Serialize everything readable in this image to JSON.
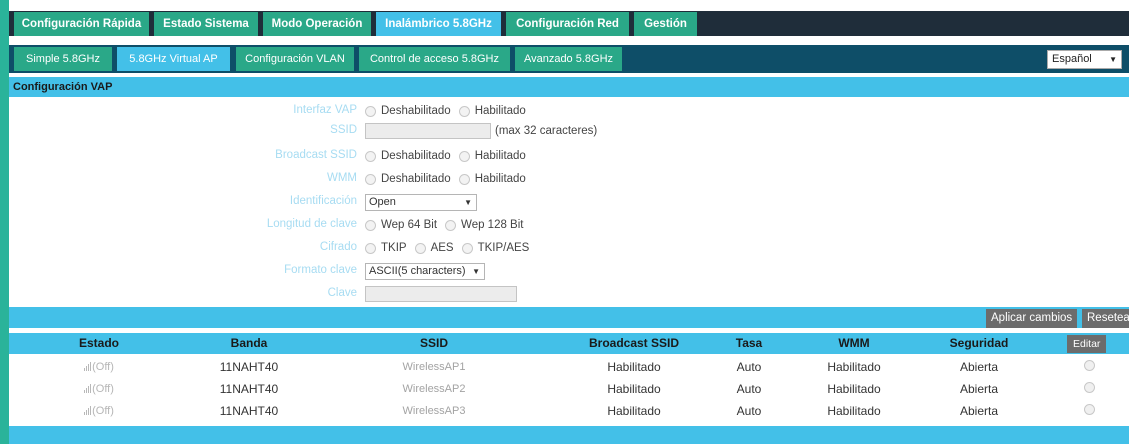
{
  "top_nav": [
    {
      "label": "Configuración Rápida",
      "active": false
    },
    {
      "label": "Estado Sistema",
      "active": false
    },
    {
      "label": "Modo Operación",
      "active": false
    },
    {
      "label": "Inalámbrico 5.8GHz",
      "active": true
    },
    {
      "label": "Configuración Red",
      "active": false
    },
    {
      "label": "Gestión",
      "active": false
    }
  ],
  "sub_nav": [
    {
      "label": "Simple 5.8GHz",
      "active": false
    },
    {
      "label": "5.8GHz Virtual AP",
      "active": true
    },
    {
      "label": "Configuración VLAN",
      "active": false
    },
    {
      "label": "Control de acceso 5.8GHz",
      "active": false
    },
    {
      "label": "Avanzado 5.8GHz",
      "active": false
    }
  ],
  "language": {
    "selected": "Español"
  },
  "section_title": "Configuración VAP",
  "form": {
    "interfaz_vap": {
      "label": "Interfaz VAP",
      "options": [
        "Deshabilitado",
        "Habilitado"
      ]
    },
    "ssid": {
      "label": "SSID",
      "value": "",
      "hint": "(max 32 caracteres)"
    },
    "broadcast_ssid": {
      "label": "Broadcast SSID",
      "options": [
        "Deshabilitado",
        "Habilitado"
      ]
    },
    "wmm": {
      "label": "WMM",
      "options": [
        "Deshabilitado",
        "Habilitado"
      ]
    },
    "identificacion": {
      "label": "Identificación",
      "selected": "Open"
    },
    "longitud_clave": {
      "label": "Longitud de clave",
      "options": [
        "Wep 64 Bit",
        "Wep 128 Bit"
      ]
    },
    "cifrado": {
      "label": "Cifrado",
      "options": [
        "TKIP",
        "AES",
        "TKIP/AES"
      ]
    },
    "formato_clave": {
      "label": "Formato clave",
      "selected": "ASCII(5 characters)"
    },
    "clave": {
      "label": "Clave",
      "value": ""
    }
  },
  "actions": {
    "apply": "Aplicar cambios",
    "reset": "Resetear"
  },
  "table": {
    "headers": [
      "Estado",
      "Banda",
      "SSID",
      "Broadcast SSID",
      "Tasa",
      "WMM",
      "Seguridad"
    ],
    "edit_label": "Editar",
    "rows": [
      {
        "estado": "(Off)",
        "banda": "11NAHT40",
        "ssid": "WirelessAP1",
        "broadcast": "Habilitado",
        "tasa": "Auto",
        "wmm": "Habilitado",
        "seguridad": "Abierta"
      },
      {
        "estado": "(Off)",
        "banda": "11NAHT40",
        "ssid": "WirelessAP2",
        "broadcast": "Habilitado",
        "tasa": "Auto",
        "wmm": "Habilitado",
        "seguridad": "Abierta"
      },
      {
        "estado": "(Off)",
        "banda": "11NAHT40",
        "ssid": "WirelessAP3",
        "broadcast": "Habilitado",
        "tasa": "Auto",
        "wmm": "Habilitado",
        "seguridad": "Abierta"
      }
    ]
  },
  "colors": {
    "accent": "#43c0e8",
    "tab": "#2aa888",
    "nav_bg": "#1f2d3a",
    "subnav_bg": "#0e4e68"
  }
}
